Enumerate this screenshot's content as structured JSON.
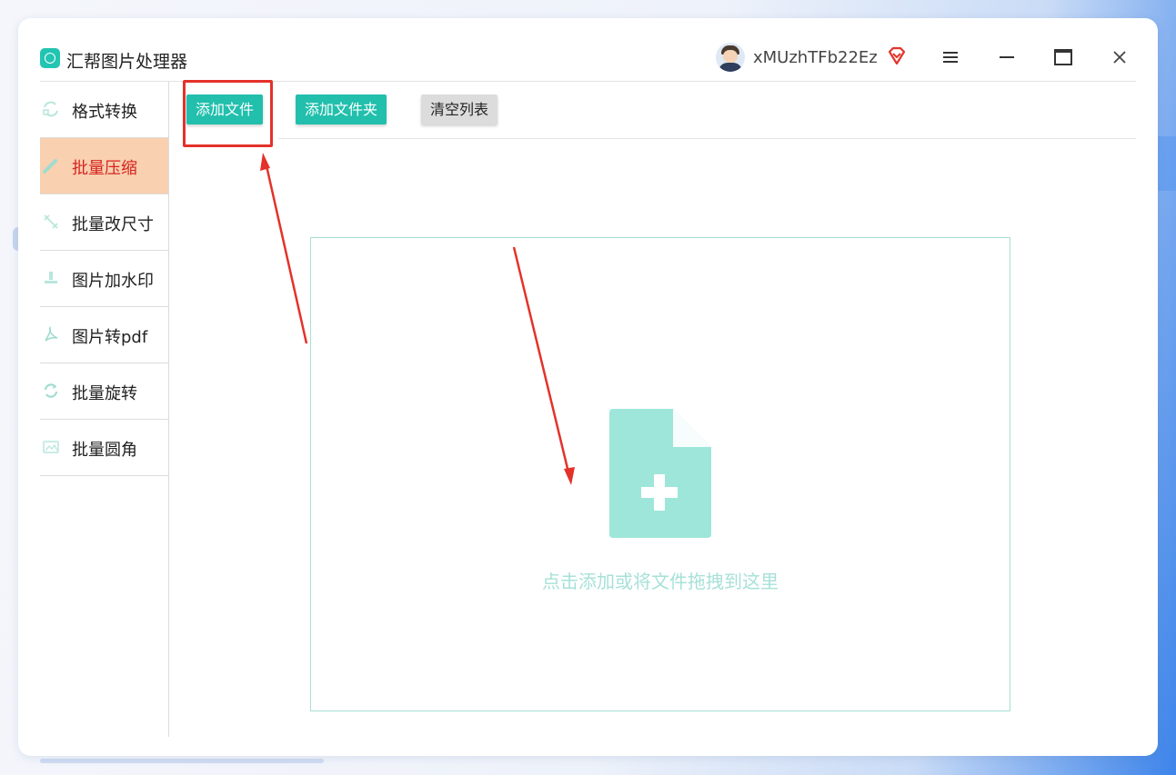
{
  "app": {
    "title": "汇帮图片处理器",
    "username": "xMUzhTFb22Ez",
    "icons": [
      "app-logo-icon",
      "vip-diamond-icon",
      "menu-icon",
      "minimize-icon",
      "maximize-icon",
      "close-icon"
    ]
  },
  "sidebar": {
    "items": [
      {
        "label": "格式转换",
        "icon": "format-convert-icon",
        "active": false
      },
      {
        "label": "批量压缩",
        "icon": "compress-icon",
        "active": true
      },
      {
        "label": "批量改尺寸",
        "icon": "resize-icon",
        "active": false
      },
      {
        "label": "图片加水印",
        "icon": "watermark-icon",
        "active": false
      },
      {
        "label": "图片转pdf",
        "icon": "pdf-icon",
        "active": false
      },
      {
        "label": "批量旋转",
        "icon": "rotate-icon",
        "active": false
      },
      {
        "label": "批量圆角",
        "icon": "round-corner-icon",
        "active": false
      }
    ]
  },
  "toolbar": {
    "add_file": "添加文件",
    "add_folder": "添加文件夹",
    "clear_list": "清空列表"
  },
  "dropzone": {
    "hint": "点击添加或将文件拖拽到这里",
    "icon": "add-file-icon"
  },
  "colors": {
    "accent": "#21bfac",
    "active_bg": "#f9d0b0",
    "active_text": "#d6231f",
    "annotation": "#e3322a"
  }
}
